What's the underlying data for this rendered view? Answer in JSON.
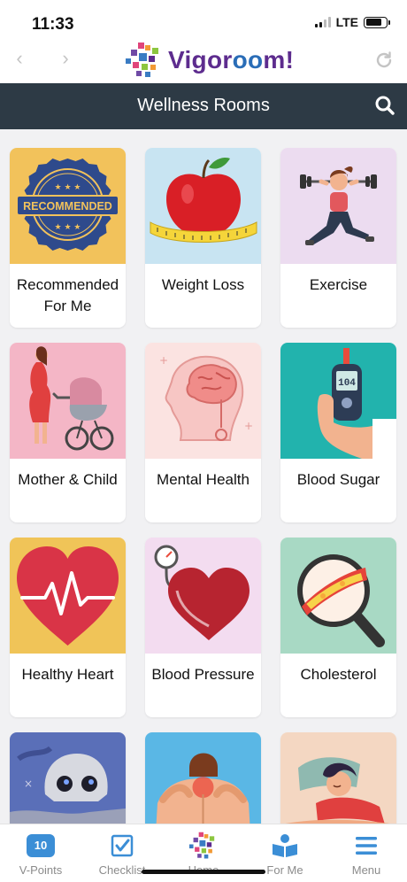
{
  "status_bar": {
    "time": "11:33",
    "network": "LTE"
  },
  "browser": {
    "back_icon": "chevron-left-icon",
    "forward_icon": "chevron-right-icon",
    "reload_icon": "reload-icon",
    "logo_text_pre": "Vigor",
    "logo_text_oo": "oo",
    "logo_text_post": "m!"
  },
  "header": {
    "title": "Wellness Rooms",
    "search_icon": "search-icon"
  },
  "rooms": [
    {
      "label": "Recommended For Me",
      "icon": "recommended-badge-icon",
      "bg": "#f2c25b"
    },
    {
      "label": "Weight Loss",
      "icon": "apple-tape-icon",
      "bg": "#c8e4f2"
    },
    {
      "label": "Exercise",
      "icon": "dumbbell-woman-icon",
      "bg": "#ecdcf0"
    },
    {
      "label": "Mother & Child",
      "icon": "pregnant-stroller-icon",
      "bg": "#f4b6c6"
    },
    {
      "label": "Mental Health",
      "icon": "brain-head-icon",
      "bg": "#fbe3e1"
    },
    {
      "label": "Blood Sugar",
      "icon": "glucometer-icon",
      "bg": "#22b3ad"
    },
    {
      "label": "Healthy Heart",
      "icon": "heart-pulse-icon",
      "bg": "#f0c458"
    },
    {
      "label": "Blood Pressure",
      "icon": "heart-gauge-icon",
      "bg": "#f3dcf0"
    },
    {
      "label": "Cholesterol",
      "icon": "artery-magnifier-icon",
      "bg": "#a8d9c4"
    },
    {
      "label": "",
      "icon": "smoking-skull-icon",
      "bg": "#5a6fb8"
    },
    {
      "label": "",
      "icon": "back-pain-icon",
      "bg": "#5ab7e5"
    },
    {
      "label": "",
      "icon": "sleeping-woman-icon",
      "bg": "#f4d7c2"
    }
  ],
  "badge_text": "RECOMMENDED",
  "glucometer_reading": "104",
  "bottom_nav": [
    {
      "label": "V-Points",
      "badge": "10",
      "icon": "points-badge-icon"
    },
    {
      "label": "Checklist",
      "icon": "checkbox-icon"
    },
    {
      "label": "Home",
      "icon": "home-logo-icon"
    },
    {
      "label": "For Me",
      "icon": "open-book-icon"
    },
    {
      "label": "Menu",
      "icon": "hamburger-icon"
    }
  ],
  "colors": {
    "header_bg": "#2d3a45",
    "accent_blue": "#3b8ed6",
    "logo_purple": "#5d2c8e"
  }
}
